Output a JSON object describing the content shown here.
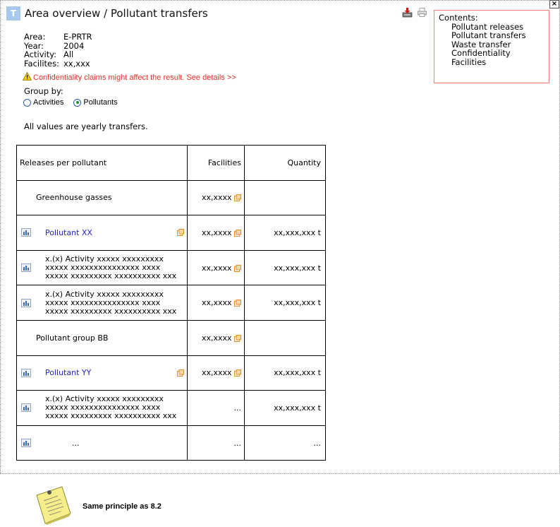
{
  "header": {
    "badge": "T",
    "title": "Area overview / Pollutant transfers",
    "close_label": "×",
    "download_icon": "download-icon",
    "print_icon": "print-icon"
  },
  "contents": {
    "heading": "Contents:",
    "items": [
      "Pollutant releases",
      "Pollutant transfers",
      "Waste transfer",
      "Confidentiality",
      "Facilities"
    ]
  },
  "meta": {
    "area_label": "Area:",
    "area_value": "E-PRTR",
    "year_label": "Year:",
    "year_value": "2004",
    "activity_label": "Activity:",
    "activity_value": "All",
    "facilities_label": "Facilites:",
    "facilities_value": "xx,xxx"
  },
  "warning": {
    "text": "Confidentiality claims might affect the result. See details >>",
    "color": "#e8312a"
  },
  "group_by": {
    "label": "Group by:",
    "options": [
      {
        "label": "Activities",
        "selected": false
      },
      {
        "label": "Pollutants",
        "selected": true
      }
    ]
  },
  "note": "All values are yearly transfers.",
  "table": {
    "headers": {
      "name": "Releases per pollutant",
      "facilities": "Facilities",
      "quantity": "Quantity"
    },
    "rows": [
      {
        "type": "group",
        "name": "Greenhouse gasses",
        "facilities": "xx,xxxx",
        "quantity": ""
      },
      {
        "type": "pollutant",
        "name": "Pollutant XX",
        "facilities": "xx,xxxx",
        "quantity": "xx,xxx,xxx t"
      },
      {
        "type": "activity",
        "line1": "x.(x) Activity xxxxx xxxxxxxxx",
        "line2": "xxxxx xxxxxxxxxxxxxxx xxxx",
        "line3": "xxxxx xxxxxxxxx xxxxxxxxxx xxx",
        "facilities": "xx,xxxx",
        "quantity": "xx,xxx,xxx t"
      },
      {
        "type": "activity",
        "line1": "x.(x) Activity xxxxx xxxxxxxxx",
        "line2": "xxxxx xxxxxxxxxxxxxxx xxxx",
        "line3": "xxxxx xxxxxxxxx xxxxxxxxxx xxx",
        "facilities": "xx,xxxx",
        "quantity": "xx,xxx,xxx t"
      },
      {
        "type": "group",
        "name": "Pollutant group BB",
        "facilities": "xx,xxxx",
        "quantity": ""
      },
      {
        "type": "pollutant",
        "name": "Pollutant YY",
        "facilities": "xx,xxxx",
        "quantity": "xx,xxx,xxx t"
      },
      {
        "type": "activity",
        "line1": "x.(x) Activity xxxxx xxxxxxxxx",
        "line2": "xxxxx xxxxxxxxxxxxxxx xxxx",
        "line3": "xxxxx xxxxxxxxx xxxxxxxxxx xxx",
        "facilities": "...",
        "quantity": "xx,xxx,xxx t"
      },
      {
        "type": "more",
        "name": "...",
        "facilities": "...",
        "quantity": "..."
      }
    ]
  },
  "sticky_note": "Same principle as 8.2",
  "colors": {
    "link": "#2222cc",
    "badge": "#a9c8ee",
    "contents_border": "#f08070",
    "external_icon": "#f08a1e"
  }
}
